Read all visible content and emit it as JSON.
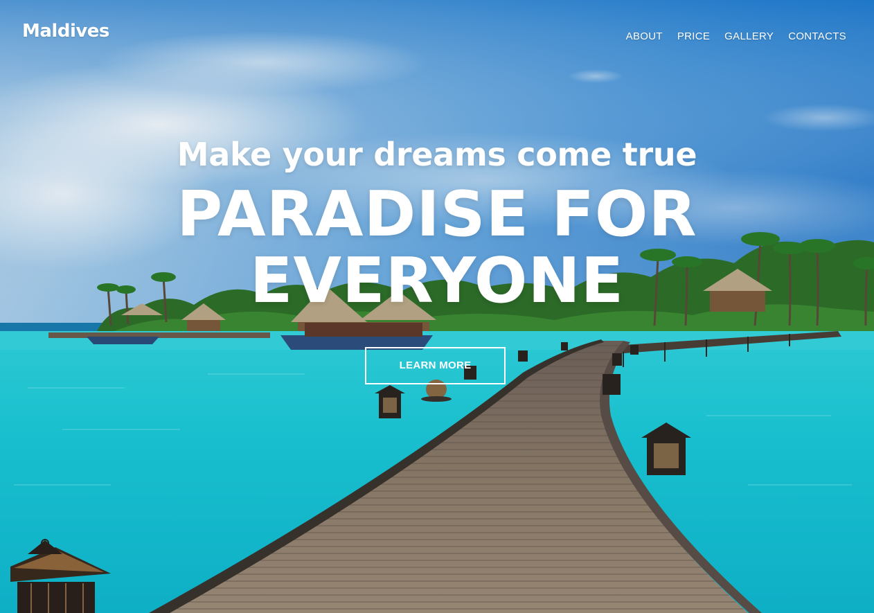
{
  "brand": {
    "logo_text": "Maldives"
  },
  "nav": {
    "items": [
      {
        "label": "ABOUT"
      },
      {
        "label": "PRICE"
      },
      {
        "label": "GALLERY"
      },
      {
        "label": "CONTACTS"
      }
    ]
  },
  "hero": {
    "tagline": "Make your dreams come true",
    "headline_line1": "PARADISE FOR",
    "headline_line2": "EVERYONE",
    "cta_label": "LEARN MORE"
  },
  "colors": {
    "sky_top": "#0f6cc8",
    "sky_light": "#cfe4f4",
    "lagoon": "#1fd0d9",
    "lagoon_deep": "#0bb4c9",
    "boardwalk": "#8a7a6a",
    "palm_green": "#2f7d2a",
    "sand": "#f0e6cf",
    "text": "#ffffff"
  }
}
